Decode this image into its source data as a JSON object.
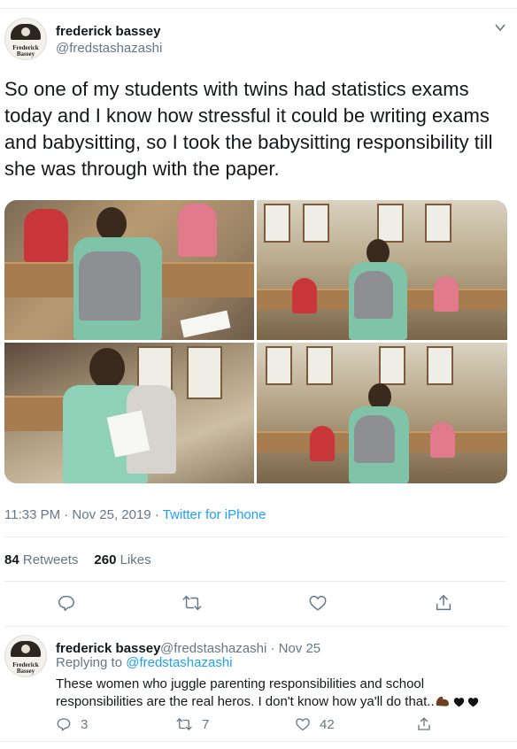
{
  "tweet": {
    "author": {
      "display_name": "frederick bassey",
      "handle": "@fredstashazashi",
      "avatar_text_line1": "Frederick",
      "avatar_text_line2": "Bassey"
    },
    "text": "So one of my students with twins had statistics exams today and I know how stressful it could be writing exams and babysitting, so I took the babysitting responsibility till she was through with the paper.",
    "timestamp": "11:33 PM · Nov 25, 2019 · ",
    "source": "Twitter for iPhone",
    "stats": {
      "retweets_count": "84",
      "retweets_label": "Retweets",
      "likes_count": "260",
      "likes_label": "Likes"
    },
    "icons": [
      "reply-icon",
      "retweet-icon",
      "like-icon",
      "share-icon",
      "chevron-down-icon"
    ]
  },
  "reply": {
    "author": {
      "display_name": "frederick bassey",
      "handle_time": "@fredstashazashi · Nov 25",
      "avatar_text_line1": "Frederick",
      "avatar_text_line2": "Bassey"
    },
    "replying_prefix": "Replying to ",
    "replying_to": "@fredstashazashi",
    "text": "These women who juggle parenting responsibilities and school responsibilities are the real heros. I don't know how ya'll do that..",
    "emojis": [
      "muscle-emoji-dark",
      "black-heart-emoji",
      "black-heart-emoji"
    ],
    "counts": {
      "replies": "3",
      "retweets": "7",
      "likes": "42"
    }
  },
  "colors": {
    "text": "#14171a",
    "secondary": "#657786",
    "link": "#1da1f2",
    "border": "#e6ecf0"
  }
}
